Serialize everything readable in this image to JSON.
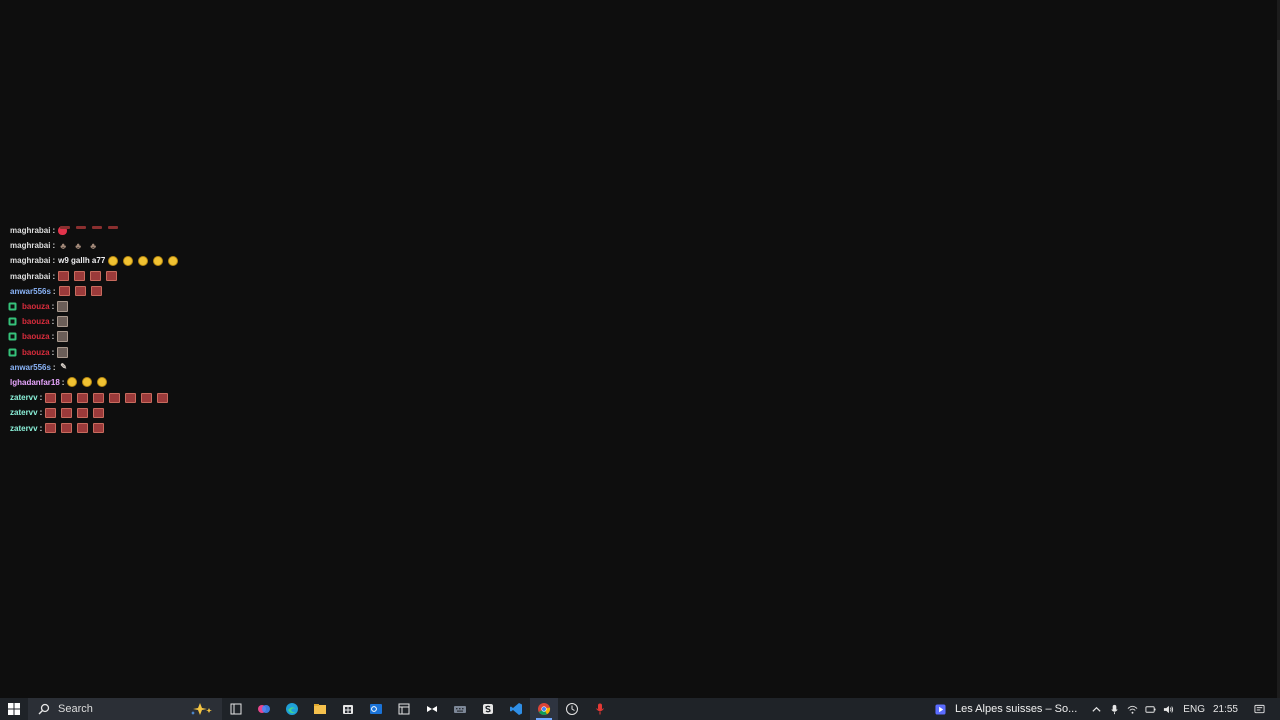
{
  "chat": {
    "messages": [
      {
        "user": "maghrabai",
        "user_color": "#dedede",
        "badge": false,
        "text": "",
        "emotes": [
          "red-heart"
        ]
      },
      {
        "user": "maghrabai",
        "user_color": "#dedede",
        "badge": false,
        "text": "",
        "emotes": [
          "thumb",
          "thumb",
          "thumb"
        ]
      },
      {
        "user": "maghrabai",
        "user_color": "#dedede",
        "badge": false,
        "text": "w9 gallh a77",
        "emotes": [
          "laugh",
          "laugh",
          "laugh",
          "laugh",
          "laugh"
        ]
      },
      {
        "user": "maghrabai",
        "user_color": "#dedede",
        "badge": false,
        "text": "",
        "emotes": [
          "block",
          "block",
          "block",
          "block"
        ]
      },
      {
        "user": "anwar556s",
        "user_color": "#8ab4f8",
        "badge": false,
        "text": "",
        "emotes": [
          "block",
          "block",
          "block"
        ]
      },
      {
        "user": "baouza",
        "user_color": "#d92c3c",
        "badge": true,
        "text": "",
        "emotes": [
          "flag"
        ]
      },
      {
        "user": "baouza",
        "user_color": "#d92c3c",
        "badge": true,
        "text": "",
        "emotes": [
          "flag"
        ]
      },
      {
        "user": "baouza",
        "user_color": "#d92c3c",
        "badge": true,
        "text": "",
        "emotes": [
          "flag"
        ]
      },
      {
        "user": "baouza",
        "user_color": "#d92c3c",
        "badge": true,
        "text": "",
        "emotes": [
          "flag"
        ]
      },
      {
        "user": "anwar556s",
        "user_color": "#8ab4f8",
        "badge": false,
        "text": "",
        "emotes": [
          "small"
        ]
      },
      {
        "user": "lghadanfar18",
        "user_color": "#e8a6ff",
        "badge": false,
        "text": "",
        "emotes": [
          "laugh",
          "laugh",
          "laugh"
        ]
      },
      {
        "user": "zatervv",
        "user_color": "#8af0d8",
        "badge": false,
        "text": "",
        "emotes": [
          "block",
          "block",
          "block",
          "block",
          "block",
          "block",
          "block",
          "block"
        ]
      },
      {
        "user": "zatervv",
        "user_color": "#8af0d8",
        "badge": false,
        "text": "",
        "emotes": [
          "block",
          "block",
          "block",
          "block"
        ]
      },
      {
        "user": "zatervv",
        "user_color": "#8af0d8",
        "badge": false,
        "text": "",
        "emotes": [
          "block",
          "block",
          "block",
          "block"
        ]
      }
    ]
  },
  "taskbar": {
    "search_placeholder": "Search",
    "media_title": "Les Alpes suisses – So...",
    "language": "ENG",
    "time": "21:55",
    "pinned_apps": [
      {
        "name": "task-view-icon",
        "active": false
      },
      {
        "name": "copilot-icon",
        "active": false
      },
      {
        "name": "edge-icon",
        "active": false
      },
      {
        "name": "file-explorer-icon",
        "active": false
      },
      {
        "name": "store-icon",
        "active": false
      },
      {
        "name": "outlook-icon",
        "active": false
      },
      {
        "name": "media-app-icon",
        "active": false
      },
      {
        "name": "capcut-icon",
        "active": false
      },
      {
        "name": "keyboard-icon",
        "active": false
      },
      {
        "name": "app-s-icon",
        "active": false
      },
      {
        "name": "vscode-icon",
        "active": false
      },
      {
        "name": "chrome-icon",
        "active": true
      },
      {
        "name": "clock-app-icon",
        "active": false
      },
      {
        "name": "microphone-app-icon",
        "active": false
      }
    ],
    "accent_color": "#6fa8ff"
  }
}
